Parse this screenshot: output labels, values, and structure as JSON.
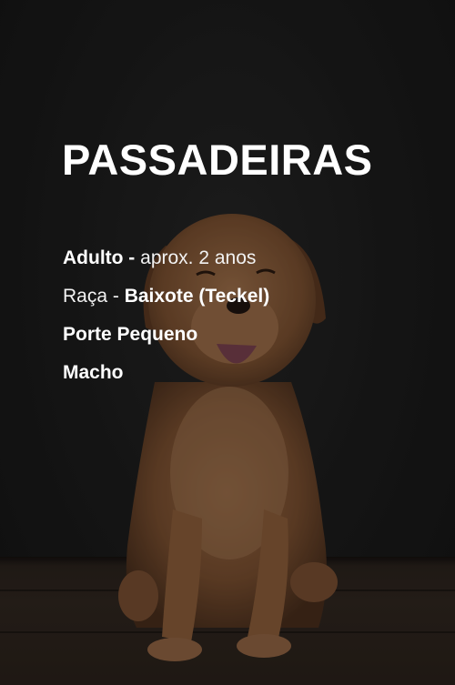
{
  "card": {
    "title": "PASSADEIRAS",
    "age_label": "Adulto -",
    "age_value": "aprox. 2 anos",
    "breed_label": "Raça -",
    "breed_value": "Baixote (Teckel)",
    "size": "Porte Pequeno",
    "sex": "Macho"
  },
  "colors": {
    "background": "#1b1b1b",
    "text": "#ffffff",
    "dog_fur": "#8a5a36"
  }
}
